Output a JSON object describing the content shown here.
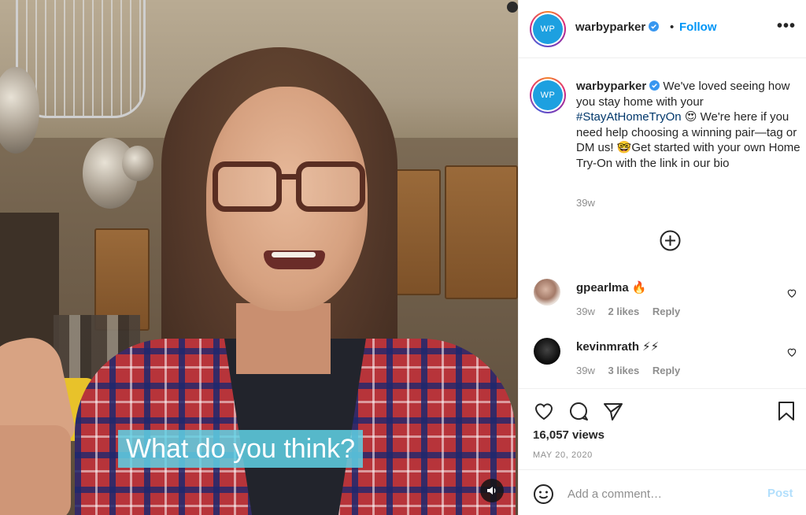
{
  "video": {
    "caption": "What do you think?",
    "mute_icon": "speaker-icon"
  },
  "header": {
    "username": "warbyparker",
    "avatar_initials": "WP",
    "separator": "•",
    "follow_label": "Follow",
    "more_label": "•••",
    "verified_color": "#3897f0"
  },
  "post": {
    "username": "warbyparker",
    "caption_part1": "We've loved seeing how you stay home with your ",
    "hashtag": "#StayAtHomeTryOn",
    "emoji1": "😍",
    "caption_part2": " We're here if you need help choosing a winning pair—tag or DM us! ",
    "emoji2": "🤓",
    "caption_part3": "Get started with your own Home Try-On with the link in our bio",
    "time": "39w",
    "load_more_icon": "plus-circle-icon"
  },
  "comments": [
    {
      "username": "gpearlma",
      "text": "🔥",
      "time": "39w",
      "likes": "2 likes",
      "reply": "Reply"
    },
    {
      "username": "kevinmrath",
      "text": "⚡⚡",
      "time": "39w",
      "likes": "3 likes",
      "reply": "Reply"
    }
  ],
  "actions": {
    "views": "16,057 views",
    "date": "MAY 20, 2020"
  },
  "composer": {
    "placeholder": "Add a comment…",
    "post_label": "Post"
  },
  "colors": {
    "link_blue": "#0095f6",
    "hashtag": "#00376b",
    "muted": "#8e8e8e",
    "post_disabled": "#b2dffc",
    "caption_bg": "#5fd2e6"
  }
}
